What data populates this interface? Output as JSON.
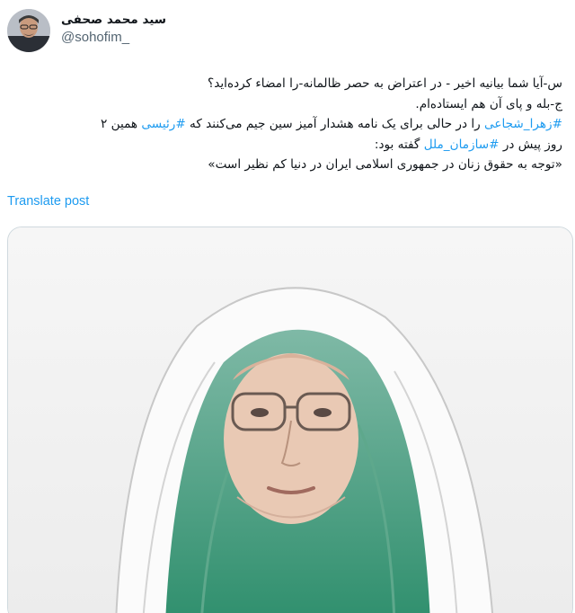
{
  "author": {
    "display_name": "سید محمد صحفی",
    "handle": "@sohofim_",
    "avatar_icon": "profile-photo-icon"
  },
  "tweet": {
    "line1": "س-آیا شما بیانیه اخیر - در اعتراض به حصر ظالمانه-را امضاء کرده‌اید؟",
    "line2": "ج-بله و پای آن هم ایستاده‌ام.",
    "line3_hashtag1": "#زهرا_شجاعی",
    "line3_mid": " را در حالی برای یک نامه هشدار آمیز سین جیم می‌کنند که ",
    "line3_hashtag2": "#رئیسی",
    "line3_end": " همین ۲",
    "line4_start": "روز پیش در ",
    "line4_hashtag": "#سازمان_ملل",
    "line4_end": " گفته بود:",
    "line5": "«توجه به حقوق زنان در جمهوری اسلامی ایران در دنیا کم نظیر است»"
  },
  "translate_label": "Translate post",
  "media": {
    "description_icon": "portrait-illustration-icon"
  },
  "colors": {
    "link": "#1d9bf0",
    "text": "#0f1419",
    "secondary": "#536471",
    "border": "#cfd9de"
  }
}
